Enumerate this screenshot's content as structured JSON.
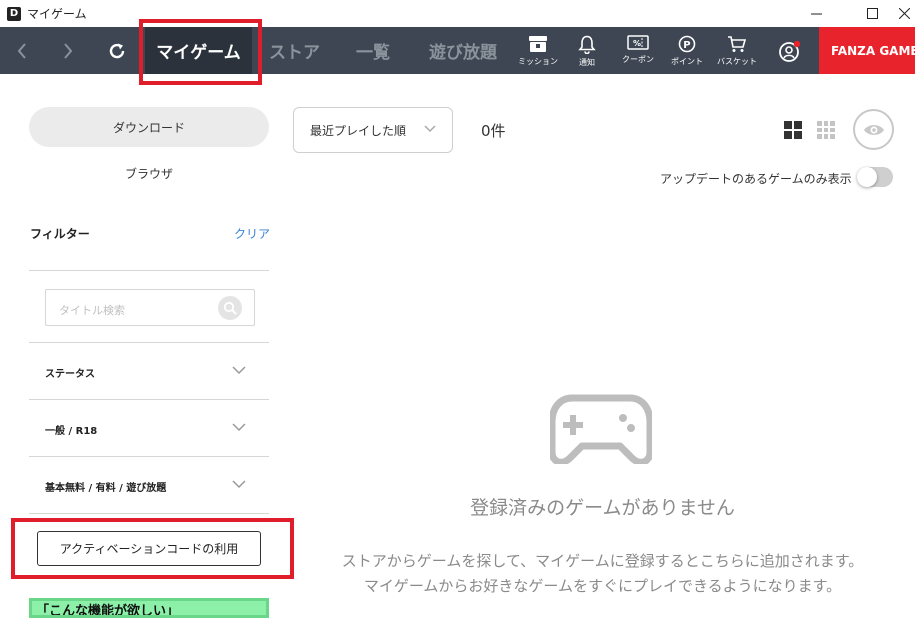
{
  "window": {
    "app_logo": "D",
    "title": "マイゲーム",
    "minimize_icon": "minimize-icon",
    "maximize_icon": "maximize-icon",
    "close_icon": "close-icon"
  },
  "navbar": {
    "tabs": [
      {
        "label": "マイゲーム",
        "active": true
      },
      {
        "label": "ストア"
      },
      {
        "label": "一覧"
      },
      {
        "label": "遊び放題"
      }
    ],
    "icons": [
      {
        "icon": "mission-icon",
        "label": "ミッション"
      },
      {
        "icon": "bell-icon",
        "label": "通知"
      },
      {
        "icon": "coupon-icon",
        "label": "クーポン"
      },
      {
        "icon": "point-icon",
        "label": "ポイント"
      },
      {
        "icon": "cart-icon",
        "label": "バスケット"
      }
    ],
    "account_icon": "account-icon",
    "fanza_label": "FANZA GAMES",
    "colors": {
      "bar": "#3d4652",
      "active_tab": "#2c323b",
      "fanza": "#e8232b",
      "highlight": "#e01e2b"
    }
  },
  "sidebar": {
    "download_label": "ダウンロード",
    "browser_label": "ブラウザ",
    "filter_title": "フィルター",
    "clear_label": "クリア",
    "search_placeholder": "タイトル検索",
    "filters": [
      {
        "label": "ステータス"
      },
      {
        "label": "一般 / R18"
      },
      {
        "label": "基本無料 / 有料 / 遊び放題"
      }
    ],
    "activation_label": "アクティベーションコードの利用",
    "banner_text": "「こんな機能が欲しい」"
  },
  "main": {
    "sort_selected": "最近プレイした順",
    "count": "0件",
    "update_toggle_label": "アップデートのあるゲームのみ表示",
    "update_toggle_on": false,
    "empty_title": "登録済みのゲームがありません",
    "empty_desc_1": "ストアからゲームを探して、マイゲームに登録するとこちらに追加されます。",
    "empty_desc_2": "マイゲームからお好きなゲームをすぐにプレイできるようになります。"
  }
}
